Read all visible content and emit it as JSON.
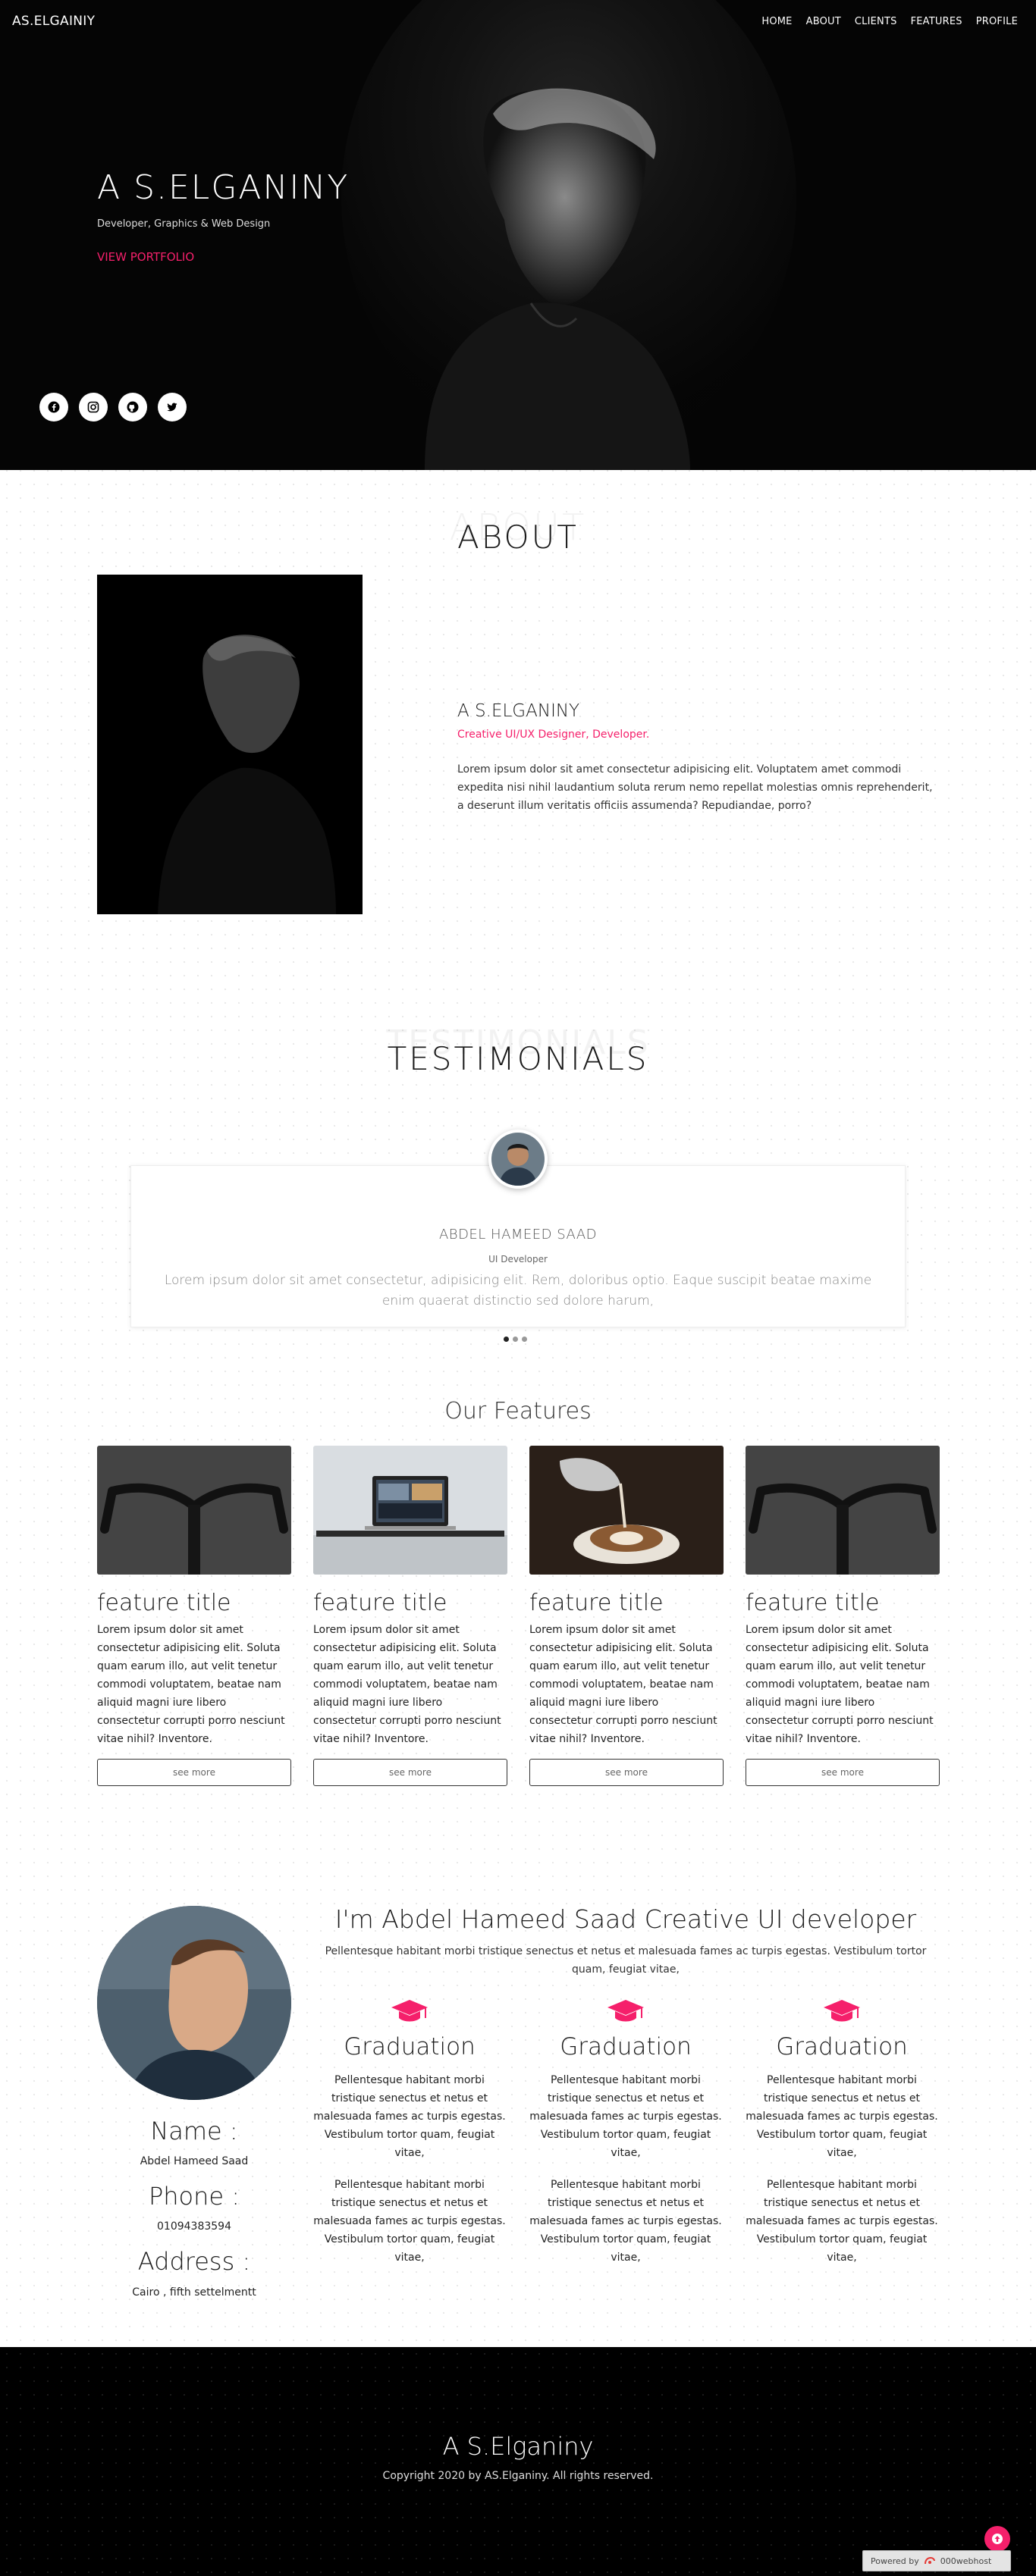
{
  "nav": {
    "brand": "AS.ELGAINIY",
    "links": [
      "HOME",
      "ABOUT",
      "CLIENTS",
      "FEATURES",
      "PROFILE"
    ]
  },
  "hero": {
    "title": "A S.ELGANINY",
    "subtitle": "Developer, Graphics & Web Design",
    "cta": "VIEW PORTFOLIO",
    "socials": [
      "facebook-icon",
      "instagram-icon",
      "github-icon",
      "twitter-icon"
    ]
  },
  "about": {
    "title": "ABOUT",
    "ghost": "ABOUT",
    "name": "A S.ELGANINY",
    "role": "Creative UI/UX Designer, Developer.",
    "text": "Lorem ipsum dolor sit amet consectetur adipisicing elit. Voluptatem amet commodi expedita nisi nihil laudantium soluta rerum nemo repellat molestias omnis reprehenderit, a deserunt illum veritatis officiis assumenda? Repudiandae, porro?"
  },
  "testimonials": {
    "ghost": "TESTIMONIALS",
    "title": "TESTIMONIALS",
    "name": "ABDEL HAMEED SAAD",
    "role": "UI Developer",
    "text": "Lorem ipsum dolor sit amet consectetur, adipisicing elit. Rem, doloribus optio. Eaque suscipit beatae maxime enim quaerat distinctio sed dolore harum,",
    "slides": 3,
    "active_slide": 1
  },
  "features": {
    "title": "Our Features",
    "items": [
      {
        "title": "feature title",
        "text": "Lorem ipsum dolor sit amet consectetur adipisicing elit. Soluta quam earum illo, aut velit tenetur commodi voluptatem, beatae nam aliquid magni iure libero consectetur corrupti porro nesciunt vitae nihil? Inventore.",
        "button": "see more",
        "image": "bicycle-handlebar"
      },
      {
        "title": "feature title",
        "text": "Lorem ipsum dolor sit amet consectetur adipisicing elit. Soluta quam earum illo, aut velit tenetur commodi voluptatem, beatae nam aliquid magni iure libero consectetur corrupti porro nesciunt vitae nihil? Inventore.",
        "button": "see more",
        "image": "laptop-on-desk"
      },
      {
        "title": "feature title",
        "text": "Lorem ipsum dolor sit amet consectetur adipisicing elit. Soluta quam earum illo, aut velit tenetur commodi voluptatem, beatae nam aliquid magni iure libero consectetur corrupti porro nesciunt vitae nihil? Inventore.",
        "button": "see more",
        "image": "latte-art"
      },
      {
        "title": "feature title",
        "text": "Lorem ipsum dolor sit amet consectetur adipisicing elit. Soluta quam earum illo, aut velit tenetur commodi voluptatem, beatae nam aliquid magni iure libero consectetur corrupti porro nesciunt vitae nihil? Inventore.",
        "button": "see more",
        "image": "bicycle-handlebar"
      }
    ]
  },
  "profile": {
    "name_label": "Name :",
    "name_value": "Abdel Hameed Saad",
    "phone_label": "Phone :",
    "phone_value": "01094383594",
    "address_label": "Address :",
    "address_value": "Cairo , fifth settelmentt",
    "heading": "I'm Abdel Hameed Saad Creative UI developer",
    "sub": "Pellentesque habitant morbi tristique senectus et netus et malesuada fames ac turpis egestas. Vestibulum tortor quam, feugiat vitae,",
    "columns": [
      {
        "title": "Graduation",
        "p1": "Pellentesque habitant morbi tristique senectus et netus et malesuada fames ac turpis egestas. Vestibulum tortor quam, feugiat vitae,",
        "p2": "Pellentesque habitant morbi tristique senectus et netus et malesuada fames ac turpis egestas. Vestibulum tortor quam, feugiat vitae,"
      },
      {
        "title": "Graduation",
        "p1": "Pellentesque habitant morbi tristique senectus et netus et malesuada fames ac turpis egestas. Vestibulum tortor quam, feugiat vitae,",
        "p2": "Pellentesque habitant morbi tristique senectus et netus et malesuada fames ac turpis egestas. Vestibulum tortor quam, feugiat vitae,"
      },
      {
        "title": "Graduation",
        "p1": "Pellentesque habitant morbi tristique senectus et netus et malesuada fames ac turpis egestas. Vestibulum tortor quam, feugiat vitae,",
        "p2": "Pellentesque habitant morbi tristique senectus et netus et malesuada fames ac turpis egestas. Vestibulum tortor quam, feugiat vitae,"
      }
    ]
  },
  "footer": {
    "title": "A S.Elganiny",
    "copyright": "Copyright 2020 by AS.Elganiny. All rights reserved.",
    "badge_prefix": "Powered by",
    "badge_host": "000webhost"
  },
  "colors": {
    "accent": "#f5206b",
    "dark": "#050505"
  }
}
